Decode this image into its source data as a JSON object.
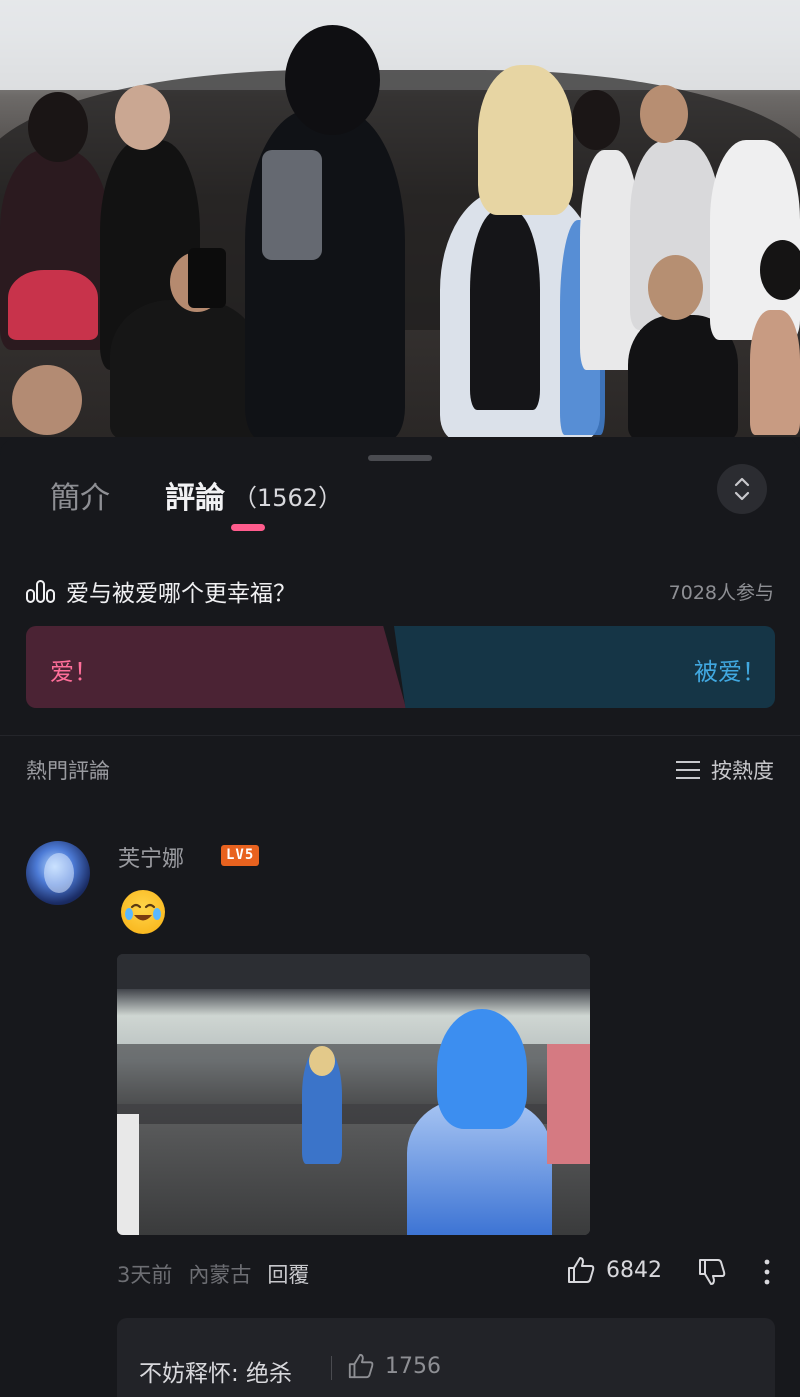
{
  "tabs": {
    "intro": "簡介",
    "comments": "評論",
    "comment_count": "（1562）"
  },
  "poll": {
    "question": "爱与被爱哪个更幸福？",
    "participants": "7028人参与",
    "option_a": "爱！",
    "option_b": "被爱！",
    "colors": {
      "option_a": "#ff6f9a",
      "option_b": "#41a8e0"
    }
  },
  "hot_comments": {
    "title": "熱門評論",
    "sort_label": "按熱度"
  },
  "comment": {
    "username": "芙宁娜",
    "level": "LV5",
    "emoji": "crying-laughing-emoji",
    "time": "3天前",
    "location": "內蒙古",
    "reply_label": "回覆",
    "likes": "6842"
  },
  "reply": {
    "text": "不妨释怀: 绝杀",
    "likes": "1756"
  },
  "accent_color": "#ff5c8d"
}
